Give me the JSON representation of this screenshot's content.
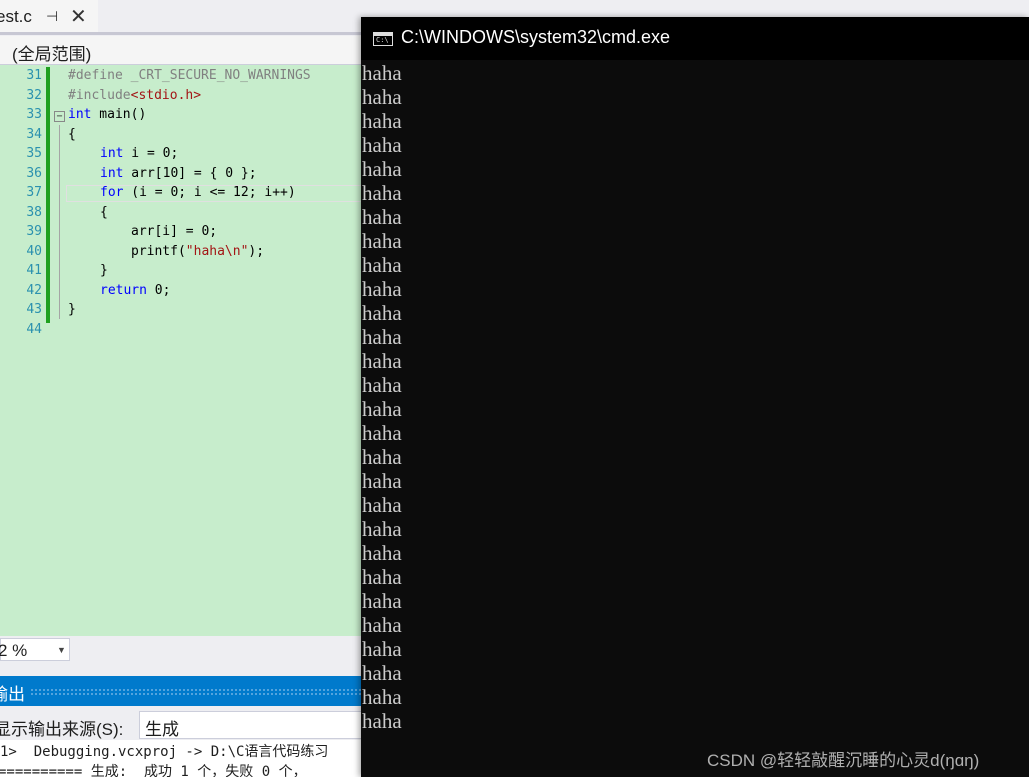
{
  "vs": {
    "tab": {
      "title": "est.c",
      "pin_glyph": "⊣",
      "close_glyph": "✕"
    },
    "scope": "(全局范围)",
    "line_numbers": [
      "31",
      "32",
      "33",
      "34",
      "35",
      "36",
      "37",
      "38",
      "39",
      "40",
      "41",
      "42",
      "43",
      "44"
    ],
    "code": {
      "l31": "#define _CRT_SECURE_NO_WARNINGS",
      "l32_kw": "#include",
      "l32_hdr": "<stdio.h>",
      "l33_kw": "int",
      "l33_rest": " main()",
      "l34": "{",
      "l35_kw": "int",
      "l35_rest": " i = 0;",
      "l36_kw": "int",
      "l36_rest": " arr[10] = { 0 };",
      "l37_kw": "for",
      "l37_rest": " (i = 0; i <= 12; i++)",
      "l38": "{",
      "l39": "arr[i] = 0;",
      "l40_fn": "printf(",
      "l40_str": "\"haha\\n\"",
      "l40_end": ");",
      "l41": "}",
      "l42_kw": "return",
      "l42_rest": " 0;",
      "l43": "}"
    },
    "zoom": "2 %",
    "output": {
      "title": "输出",
      "source_label": "显示输出来源(S):",
      "source_value": "生成",
      "line1": "1>  Debugging.vcxproj -> D:\\C语言代码练习",
      "line2": "========== 生成:  成功 1 个，失败 0 个，"
    }
  },
  "cmd": {
    "title": "C:\\WINDOWS\\system32\\cmd.exe",
    "icon": "console-icon",
    "output_lines": [
      "haha",
      "haha",
      "haha",
      "haha",
      "haha",
      "haha",
      "haha",
      "haha",
      "haha",
      "haha",
      "haha",
      "haha",
      "haha",
      "haha",
      "haha",
      "haha",
      "haha",
      "haha",
      "haha",
      "haha",
      "haha",
      "haha",
      "haha",
      "haha",
      "haha",
      "haha",
      "haha",
      "haha"
    ]
  },
  "watermark": "CSDN @轻轻敲醒沉睡的心灵d(ŋɑŋ)"
}
